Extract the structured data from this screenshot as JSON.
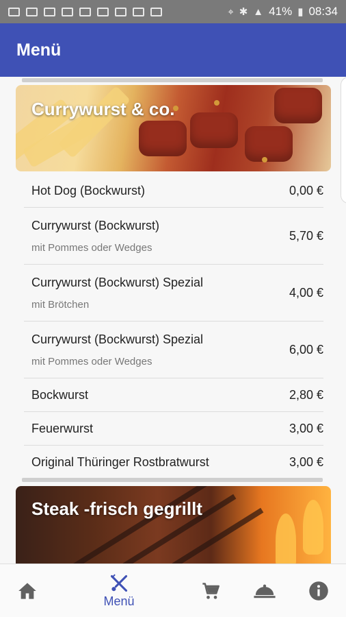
{
  "status_bar": {
    "battery": "41%",
    "time": "08:34"
  },
  "app_bar": {
    "title": "Menü"
  },
  "sections": [
    {
      "title": "Currywurst & co.",
      "items": [
        {
          "name": "Hot Dog (Bockwurst)",
          "subtitle": "",
          "price": "0,00 €"
        },
        {
          "name": "Currywurst (Bockwurst)",
          "subtitle": "mit Pommes oder Wedges",
          "price": "5,70 €"
        },
        {
          "name": "Currywurst (Bockwurst) Spezial",
          "subtitle": "mit Brötchen",
          "price": "4,00 €"
        },
        {
          "name": "Currywurst (Bockwurst) Spezial",
          "subtitle": "mit Pommes oder Wedges",
          "price": "6,00 €"
        },
        {
          "name": "Bockwurst",
          "subtitle": "",
          "price": "2,80 €"
        },
        {
          "name": "Feuerwurst",
          "subtitle": "",
          "price": "3,00 €"
        },
        {
          "name": "Original Thüringer Rostbratwurst",
          "subtitle": "",
          "price": "3,00 €"
        }
      ]
    },
    {
      "title": "Steak -frisch gegrillt",
      "items": []
    }
  ],
  "bottom_nav": {
    "items": [
      {
        "icon": "home-icon",
        "label": ""
      },
      {
        "icon": "cutlery-icon",
        "label": "Menü",
        "active": true
      },
      {
        "icon": "cart-icon",
        "label": ""
      },
      {
        "icon": "cloche-icon",
        "label": ""
      },
      {
        "icon": "info-icon",
        "label": ""
      }
    ]
  },
  "colors": {
    "primary": "#3f51b5",
    "status_bar": "#7a7a7a"
  }
}
